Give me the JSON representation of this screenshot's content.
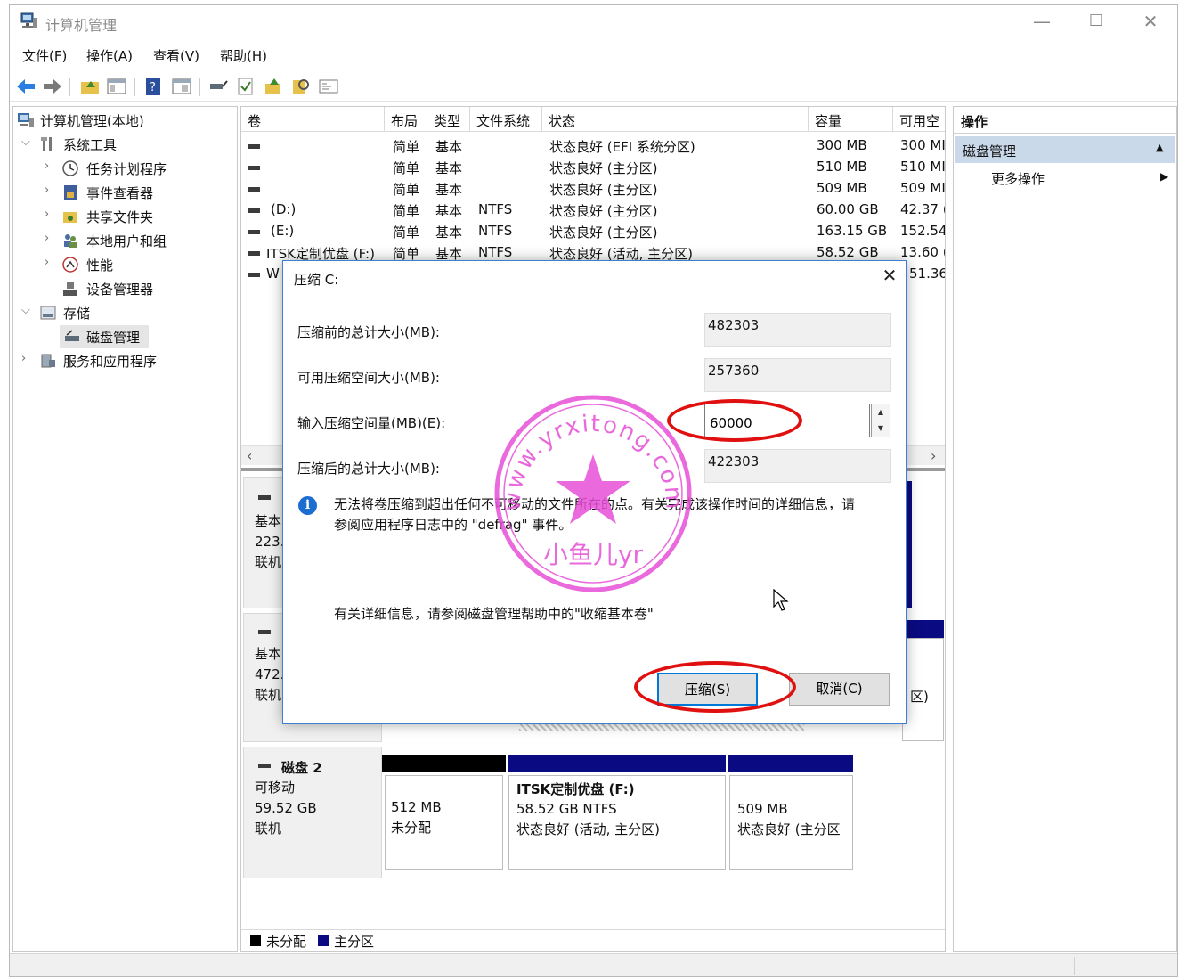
{
  "window": {
    "title": "计算机管理",
    "minimize_glyph": "—",
    "maximize_glyph": "☐",
    "close_glyph": "✕"
  },
  "menu": [
    "文件(F)",
    "操作(A)",
    "查看(V)",
    "帮助(H)"
  ],
  "toolbar_icons": [
    "back-icon",
    "forward-icon",
    "up-folder-icon",
    "show-hide-tree-icon",
    "help-icon",
    "properties-icon",
    "disk-connect-icon",
    "check-icon",
    "export-icon",
    "search-icon",
    "console-icon"
  ],
  "tree": {
    "root": "计算机管理(本地)",
    "system_tools": "系统工具",
    "task_scheduler": "任务计划程序",
    "event_viewer": "事件查看器",
    "shared_folders": "共享文件夹",
    "local_users": "本地用户和组",
    "performance": "性能",
    "device_manager": "设备管理器",
    "storage": "存储",
    "disk_management": "磁盘管理",
    "services_apps": "服务和应用程序"
  },
  "columns": [
    "卷",
    "布局",
    "类型",
    "文件系统",
    "状态",
    "容量",
    "可用空间"
  ],
  "columns_display": [
    "卷",
    "布局",
    "类型",
    "文件系统",
    "状态",
    "容量",
    "可用空"
  ],
  "volumes": [
    {
      "name": "",
      "layout": "简单",
      "type": "基本",
      "fs": "",
      "status": "状态良好 (EFI 系统分区)",
      "capacity": "300 MB",
      "free": "300 MI"
    },
    {
      "name": "",
      "layout": "简单",
      "type": "基本",
      "fs": "",
      "status": "状态良好 (主分区)",
      "capacity": "510 MB",
      "free": "510 MI"
    },
    {
      "name": "",
      "layout": "简单",
      "type": "基本",
      "fs": "",
      "status": "状态良好 (主分区)",
      "capacity": "509 MB",
      "free": "509 MI"
    },
    {
      "name": "(D:)",
      "layout": "简单",
      "type": "基本",
      "fs": "NTFS",
      "status": "状态良好 (主分区)",
      "capacity": "60.00 GB",
      "free": "42.37 ("
    },
    {
      "name": "(E:)",
      "layout": "简单",
      "type": "基本",
      "fs": "NTFS",
      "status": "状态良好 (主分区)",
      "capacity": "163.15 GB",
      "free": "152.54"
    },
    {
      "name": "ITSK定制优盘 (F:)",
      "layout": "简单",
      "type": "基本",
      "fs": "NTFS",
      "status": "状态良好 (活动, 主分区)",
      "capacity": "58.52 GB",
      "free": "13.60 ("
    }
  ],
  "partial_row": {
    "name": "W",
    "free": "51.36"
  },
  "disks": {
    "disk0": {
      "type": "基本",
      "size": "223.",
      "status": "联机"
    },
    "disk1": {
      "type": "基本",
      "size": "472.",
      "status": "联机",
      "partial_part": "区)"
    },
    "disk2": {
      "name": "磁盘 2",
      "type": "可移动",
      "size": "59.52 GB",
      "status": "联机",
      "parts": [
        {
          "line1": "512 MB",
          "line2": "未分配",
          "line3": ""
        },
        {
          "title": "ITSK定制优盘  (F:)",
          "line1": "58.52 GB NTFS",
          "line2": "状态良好 (活动, 主分区)"
        },
        {
          "line1": "509 MB",
          "line2": "状态良好 (主分区"
        }
      ]
    }
  },
  "legend": {
    "unallocated": "未分配",
    "primary": "主分区"
  },
  "actions": {
    "header": "操作",
    "selected": "磁盘管理",
    "more": "更多操作"
  },
  "dialog": {
    "title": "压缩 C:",
    "close_glyph": "✕",
    "total_before_label": "压缩前的总计大小(MB):",
    "total_before": "482303",
    "available_label": "可用压缩空间大小(MB):",
    "available": "257360",
    "amount_label": "输入压缩空间量(MB)(E):",
    "amount": "60000",
    "total_after_label": "压缩后的总计大小(MB):",
    "total_after": "422303",
    "info_glyph": "i",
    "info_line1": "无法将卷压缩到超出任何不可移动的文件所在的点。有关完成该操作时间的详细信息，请",
    "info_line2": "参阅应用程序日志中的 \"defrag\" 事件。",
    "help": "有关详细信息，请参阅磁盘管理帮助中的\"收缩基本卷\"",
    "shrink_button": "压缩(S)",
    "cancel_button": "取消(C)"
  },
  "watermark": {
    "top_text": "www.yrxitong.com",
    "bottom_text": "小鱼儿yr"
  },
  "colors": {
    "unallocated": "#000000",
    "primary": "#0a0a82",
    "selection": "#c9d9ea",
    "annotation": "#e01010",
    "watermark": "#e64fd7"
  }
}
